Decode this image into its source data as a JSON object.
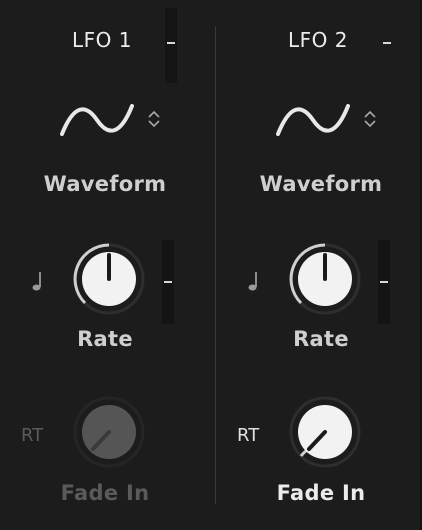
{
  "lfo1": {
    "title": "LFO 1",
    "waveform_label": "Waveform",
    "rate_label": "Rate",
    "fade_label": "Fade In",
    "rt_label": "RT",
    "fade_enabled": false,
    "rate_value": 0.5,
    "fade_value": 0.15
  },
  "lfo2": {
    "title": "LFO 2",
    "waveform_label": "Waveform",
    "rate_label": "Rate",
    "fade_label": "Fade In",
    "rt_label": "RT",
    "fade_enabled": true,
    "rate_value": 0.5,
    "fade_value": 0.15
  },
  "icons": {
    "waveform": "sine-wave-icon",
    "selector": "updown-arrows-icon",
    "sync": "quarter-note-icon"
  },
  "colors": {
    "background": "#1c1c1c",
    "knob_fill": "#f2f2f2",
    "knob_disabled": "#555555",
    "text": "#cfcfcf",
    "text_disabled": "#5a5a5a"
  }
}
